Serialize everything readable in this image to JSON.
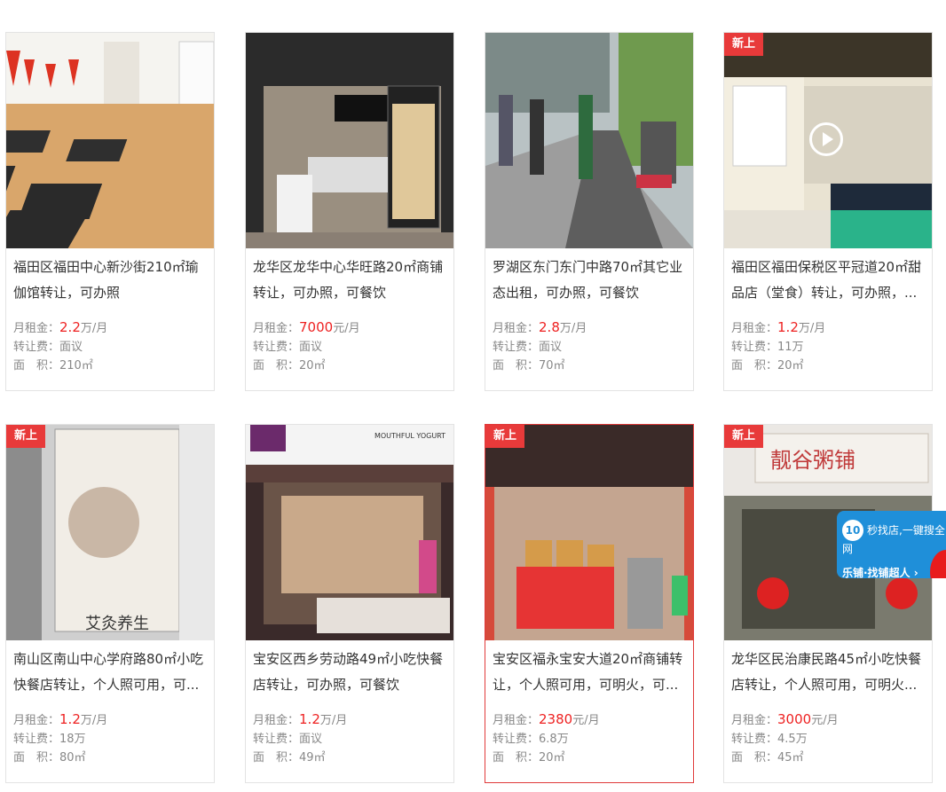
{
  "labels": {
    "rent": "月租金：",
    "transfer": "转让费：",
    "area": "面　积："
  },
  "listings": [
    {
      "title": "福田区福田中心新沙街210㎡瑜伽馆转让，可办照",
      "rent_value": "2.2",
      "rent_unit": "万/月",
      "transfer": "面议",
      "area": "210㎡",
      "badge": ""
    },
    {
      "title": "龙华区龙华中心华旺路20㎡商铺转让，可办照，可餐饮",
      "rent_value": "7000",
      "rent_unit": "元/月",
      "transfer": "面议",
      "area": "20㎡",
      "badge": ""
    },
    {
      "title": "罗湖区东门东门中路70㎡其它业态出租，可办照，可餐饮",
      "rent_value": "2.8",
      "rent_unit": "万/月",
      "transfer": "面议",
      "area": "70㎡",
      "badge": ""
    },
    {
      "title": "福田区福田保税区平冠道20㎡甜品店（堂食）转让，可办照，...",
      "rent_value": "1.2",
      "rent_unit": "万/月",
      "transfer": "11万",
      "area": "20㎡",
      "badge": "新上"
    },
    {
      "title": "南山区南山中心学府路80㎡小吃快餐店转让，个人照可用，可...",
      "rent_value": "1.2",
      "rent_unit": "万/月",
      "transfer": "18万",
      "area": "80㎡",
      "badge": "新上"
    },
    {
      "title": "宝安区西乡劳动路49㎡小吃快餐店转让，可办照，可餐饮",
      "rent_value": "1.2",
      "rent_unit": "万/月",
      "transfer": "面议",
      "area": "49㎡",
      "badge": ""
    },
    {
      "title": "宝安区福永宝安大道20㎡商铺转让，个人照可用，可明火，可...",
      "rent_value": "2380",
      "rent_unit": "元/月",
      "transfer": "6.8万",
      "area": "20㎡",
      "badge": "新上"
    },
    {
      "title": "龙华区民治康民路45㎡小吃快餐店转让，个人照可用，可明火...",
      "rent_value": "3000",
      "rent_unit": "元/月",
      "transfer": "4.5万",
      "area": "45㎡",
      "badge": "新上"
    }
  ],
  "image_text": {
    "yogurt_brand": "MOUTHFUL YOGURT",
    "moxibustion_poster": "艾灸养生",
    "congee_sign": "靓谷粥铺"
  },
  "promo": {
    "number": "10",
    "line1": "秒找店,一键搜全网",
    "line2": "乐铺·找铺超人 ›"
  },
  "colors": {
    "price_red": "#e22222",
    "badge_red": "#e83a3a",
    "promo_blue": "#1f8fd9"
  }
}
